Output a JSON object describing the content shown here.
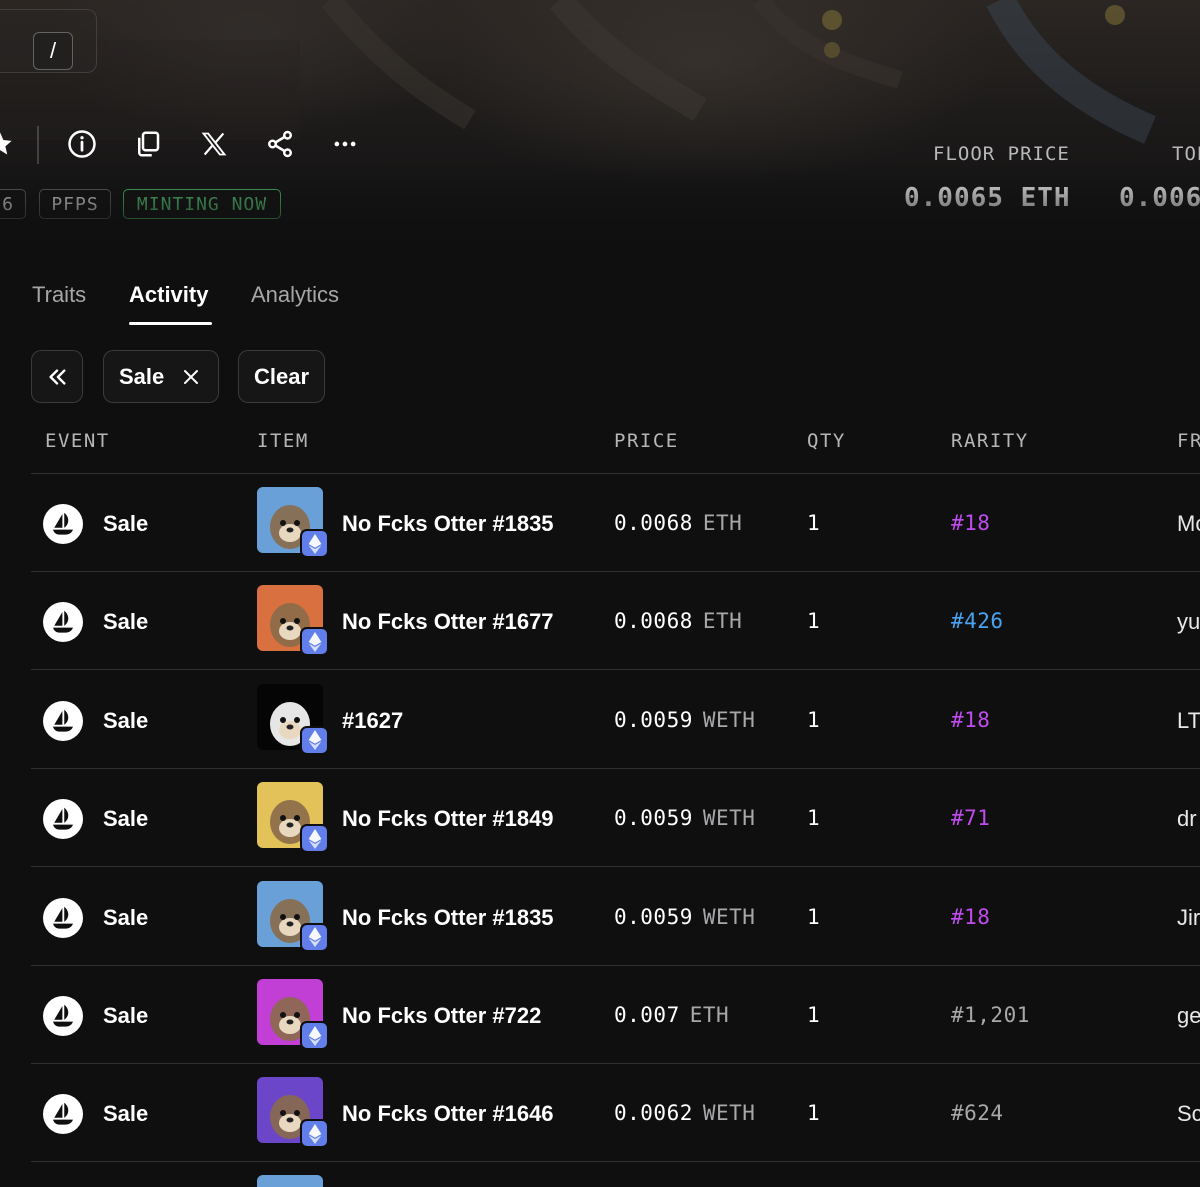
{
  "search": {
    "shortcut": "/"
  },
  "toolbar": {
    "icons": [
      "star-icon",
      "info-icon",
      "copy-icon",
      "x-logo-icon",
      "share-icon",
      "more-icon"
    ]
  },
  "tags": [
    {
      "label": "6"
    },
    {
      "label": "PFPS"
    },
    {
      "label": "MINTING NOW"
    }
  ],
  "stats": {
    "floor_label": "FLOOR PRICE",
    "floor_value": "0.0065 ETH",
    "top_label": "TOP",
    "top_value": "0.006"
  },
  "tabs": [
    {
      "label": "Traits",
      "active": false
    },
    {
      "label": "Activity",
      "active": true
    },
    {
      "label": "Analytics",
      "active": false
    }
  ],
  "filters": {
    "collapse_icon": "chevrons-left-icon",
    "chip_label": "Sale",
    "clear_label": "Clear"
  },
  "table": {
    "columns": [
      "EVENT",
      "ITEM",
      "PRICE",
      "QTY",
      "RARITY",
      "FR"
    ],
    "rows": [
      {
        "event": "Sale",
        "item": "No Fcks Otter #1835",
        "price": "0.0068",
        "unit": "ETH",
        "qty": "1",
        "rarity": "#18",
        "rarity_color": "#c04cf0",
        "from": "Mc",
        "thumb_bg": "#6aa0d8"
      },
      {
        "event": "Sale",
        "item": "No Fcks Otter #1677",
        "price": "0.0068",
        "unit": "ETH",
        "qty": "1",
        "rarity": "#426",
        "rarity_color": "#4aa3f0",
        "from": "yu",
        "thumb_bg": "#d9703f"
      },
      {
        "event": "Sale",
        "item": "#1627",
        "price": "0.0059",
        "unit": "WETH",
        "qty": "1",
        "rarity": "#18",
        "rarity_color": "#c04cf0",
        "from": "LT",
        "thumb_bg": "#050505"
      },
      {
        "event": "Sale",
        "item": "No Fcks Otter #1849",
        "price": "0.0059",
        "unit": "WETH",
        "qty": "1",
        "rarity": "#71",
        "rarity_color": "#c04cf0",
        "from": "dr",
        "thumb_bg": "#e3c25a"
      },
      {
        "event": "Sale",
        "item": "No Fcks Otter #1835",
        "price": "0.0059",
        "unit": "WETH",
        "qty": "1",
        "rarity": "#18",
        "rarity_color": "#c04cf0",
        "from": "Jir",
        "thumb_bg": "#6aa0d8"
      },
      {
        "event": "Sale",
        "item": "No Fcks Otter #722",
        "price": "0.007",
        "unit": "ETH",
        "qty": "1",
        "rarity": "#1,201",
        "rarity_color": "#a8a8aa",
        "from": "ge",
        "thumb_bg": "#c23fd6"
      },
      {
        "event": "Sale",
        "item": "No Fcks Otter #1646",
        "price": "0.0062",
        "unit": "WETH",
        "qty": "1",
        "rarity": "#624",
        "rarity_color": "#a8a8aa",
        "from": "Sc",
        "thumb_bg": "#6b46c8"
      }
    ]
  }
}
